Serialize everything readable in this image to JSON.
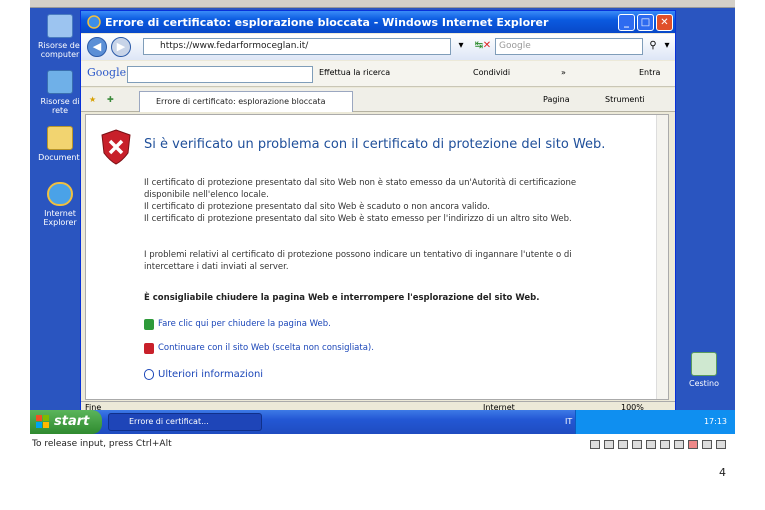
{
  "window": {
    "title": "Errore di certificato: esplorazione bloccata - Windows Internet Explorer",
    "minimize": "_",
    "maximize": "□",
    "close": "✕"
  },
  "address": {
    "url": "https://www.fedarformoceglan.it/",
    "search_placeholder": "Google"
  },
  "google_toolbar": {
    "logo": "Google",
    "search_label": "Effettua la ricerca",
    "share_label": "Condividi",
    "more": "»",
    "login_label": "Entra"
  },
  "tabs": {
    "active": "Errore di certificato: esplorazione bloccata",
    "page_label": "Pagina",
    "tools_label": "Strumenti"
  },
  "content": {
    "title": "Si è verificato un problema con il certificato di protezione del sito Web.",
    "lines": [
      "Il certificato di protezione presentato dal sito Web non è stato emesso da un'Autorità di certificazione",
      "disponibile nell'elenco locale.",
      "Il certificato di protezione presentato dal sito Web è scaduto o non ancora valido.",
      "Il certificato di protezione presentato dal sito Web è stato emesso per l'indirizzo di un altro sito Web."
    ],
    "warning": [
      "I problemi relativi al certificato di protezione possono indicare un tentativo di ingannare l'utente o di",
      "intercettare i dati inviati al server."
    ],
    "recommendation": "È consigliabile chiudere la pagina Web e interrompere l'esplorazione del sito Web.",
    "link_close": "Fare clic qui per chiudere la pagina Web.",
    "link_continue": "Continuare con il sito Web (scelta non consigliata).",
    "more_info": "Ulteriori informazioni"
  },
  "status": {
    "left": "Fine",
    "zone": "Internet",
    "zoom": "100%"
  },
  "desktop": {
    "icons": [
      "Risorse del computer",
      "Risorse di rete",
      "Documenti",
      "Internet Explorer",
      "Cestino"
    ]
  },
  "taskbar": {
    "start": "start",
    "task": "Errore di certificat...",
    "lang": "IT",
    "clock": "17:13"
  },
  "vm": {
    "release_hint": "To release input, press Ctrl+Alt"
  },
  "page_number": "4",
  "colors": {
    "titlebar": "#0a5ae0",
    "desktop": "#2a55c0",
    "link": "#1b46b8",
    "heading": "#1f4f9a"
  }
}
